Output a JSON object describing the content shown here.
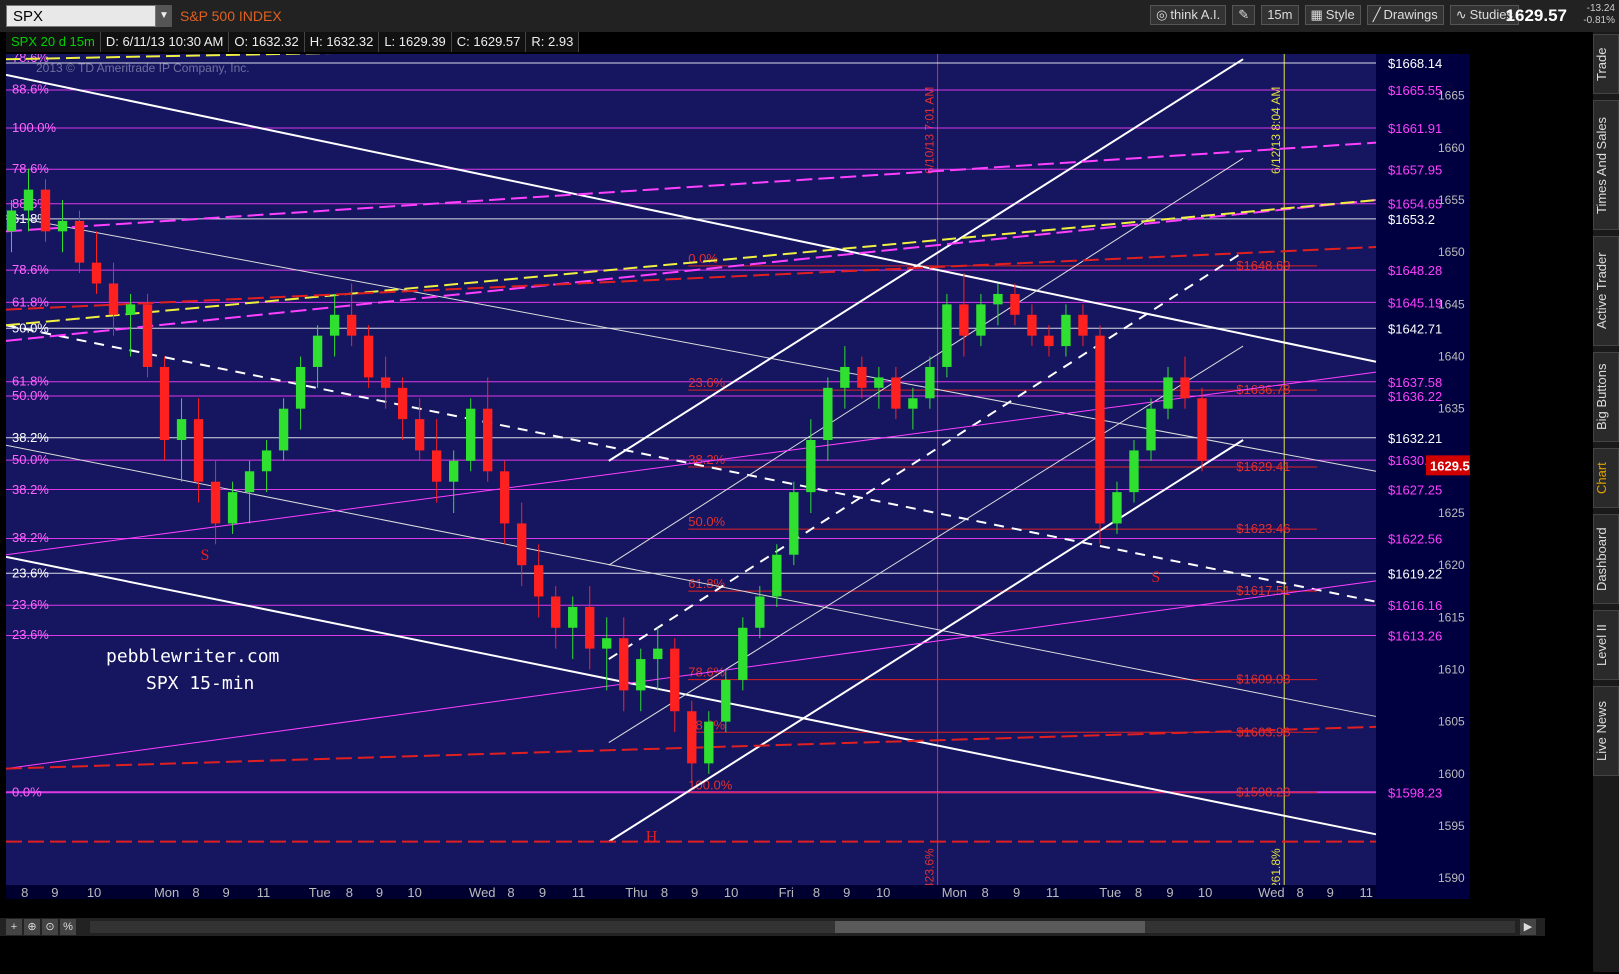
{
  "header": {
    "symbol": "SPX",
    "description": "S&P 500 INDEX",
    "last_price": "1629.57",
    "net_change": "-13.24",
    "pct_change": "-0.81%"
  },
  "toolbar": {
    "think_label": "think A.I.",
    "interval_label": "15m",
    "style_label": "Style",
    "drawings_label": "Drawings",
    "studies_label": "Studies"
  },
  "infobar": {
    "symbol_period": "SPX 20 d 15m",
    "date": "D: 6/11/13 10:30 AM",
    "open": "O: 1632.32",
    "high": "H: 1632.32",
    "low": "L: 1629.39",
    "close": "C: 1629.57",
    "range": "R: 2.93"
  },
  "sidetabs": [
    "Trade",
    "Times And Sales",
    "Active Trader",
    "Big Buttons",
    "Chart",
    "Dashboard",
    "Level II",
    "Live News"
  ],
  "chart_data": {
    "type": "candlestick",
    "title": "",
    "copyright": "2013 © TD Ameritrade IP Company, Inc.",
    "watermark_line1": "pebblewriter.com",
    "watermark_line2": "SPX 15-min",
    "ylim": [
      1588,
      1669
    ],
    "last_price_label": "1629.57",
    "y_ticks": [
      1590,
      1595,
      1600,
      1605,
      1610,
      1615,
      1620,
      1625,
      1630,
      1635,
      1640,
      1645,
      1650,
      1655,
      1660,
      1665
    ],
    "x_ticks": [
      {
        "label": "8",
        "x": 0.011
      },
      {
        "label": "9",
        "x": 0.033
      },
      {
        "label": "10",
        "x": 0.059
      },
      {
        "label": "Mon",
        "x": 0.108
      },
      {
        "label": "8",
        "x": 0.136
      },
      {
        "label": "9",
        "x": 0.158
      },
      {
        "label": "11",
        "x": 0.183
      },
      {
        "label": "Tue",
        "x": 0.221
      },
      {
        "label": "8",
        "x": 0.248
      },
      {
        "label": "9",
        "x": 0.27
      },
      {
        "label": "10",
        "x": 0.293
      },
      {
        "label": "Wed",
        "x": 0.338
      },
      {
        "label": "8",
        "x": 0.366
      },
      {
        "label": "9",
        "x": 0.389
      },
      {
        "label": "11",
        "x": 0.413
      },
      {
        "label": "Thu",
        "x": 0.452
      },
      {
        "label": "8",
        "x": 0.478
      },
      {
        "label": "9",
        "x": 0.5
      },
      {
        "label": "10",
        "x": 0.524
      },
      {
        "label": "Fri",
        "x": 0.564
      },
      {
        "label": "8",
        "x": 0.589
      },
      {
        "label": "9",
        "x": 0.611
      },
      {
        "label": "10",
        "x": 0.635
      },
      {
        "label": "Mon",
        "x": 0.683
      },
      {
        "label": "8",
        "x": 0.712
      },
      {
        "label": "9",
        "x": 0.735
      },
      {
        "label": "11",
        "x": 0.759
      },
      {
        "label": "Tue",
        "x": 0.798
      },
      {
        "label": "8",
        "x": 0.824
      },
      {
        "label": "9",
        "x": 0.847
      },
      {
        "label": "10",
        "x": 0.87
      },
      {
        "label": "Wed",
        "x": 0.914
      },
      {
        "label": "8",
        "x": 0.942
      },
      {
        "label": "9",
        "x": 0.964
      },
      {
        "label": "11",
        "x": 0.988
      }
    ],
    "vertical_markers": [
      {
        "x": 0.68,
        "label": "6/10/13 7:01 AM",
        "color": "#e03030",
        "bottom_label": "423.6%"
      },
      {
        "x": 0.933,
        "label": "6/12/13 8:04 AM",
        "color": "#e0e040",
        "bottom_label": "261.8%"
      }
    ],
    "right_levels": [
      {
        "price": 1668.14,
        "label": "$1668.14",
        "color": "#ffffff"
      },
      {
        "price": 1665.55,
        "label": "$1665.55",
        "color": "#ff40ff"
      },
      {
        "price": 1661.91,
        "label": "$1661.91",
        "color": "#ff40ff"
      },
      {
        "price": 1657.95,
        "label": "$1657.95",
        "color": "#ff40ff"
      },
      {
        "price": 1654.65,
        "label": "$1654.65",
        "color": "#ff40ff"
      },
      {
        "price": 1653.2,
        "label": "$1653.2",
        "color": "#ffffff"
      },
      {
        "price": 1648.28,
        "label": "$1648.28",
        "color": "#ff40ff"
      },
      {
        "price": 1645.19,
        "label": "$1645.19",
        "color": "#ff40ff"
      },
      {
        "price": 1642.71,
        "label": "$1642.71",
        "color": "#ffffff"
      },
      {
        "price": 1637.58,
        "label": "$1637.58",
        "color": "#ff40ff"
      },
      {
        "price": 1636.22,
        "label": "$1636.22",
        "color": "#ff40ff"
      },
      {
        "price": 1632.21,
        "label": "$1632.21",
        "color": "#ffffff"
      },
      {
        "price": 1630.07,
        "label": "$1630.07",
        "color": "#ff40ff"
      },
      {
        "price": 1627.25,
        "label": "$1627.25",
        "color": "#ff40ff"
      },
      {
        "price": 1622.56,
        "label": "$1622.56",
        "color": "#ff40ff"
      },
      {
        "price": 1619.22,
        "label": "$1619.22",
        "color": "#ffffff"
      },
      {
        "price": 1616.16,
        "label": "$1616.16",
        "color": "#ff40ff"
      },
      {
        "price": 1613.26,
        "label": "$1613.26",
        "color": "#ff40ff"
      },
      {
        "price": 1598.23,
        "label": "$1598.23",
        "color": "#ff40ff"
      }
    ],
    "left_fib_labels": [
      {
        "price": 1668.6,
        "label": "78.6%",
        "color": "#ff66ff"
      },
      {
        "price": 1665.6,
        "label": "88.6%",
        "color": "#ff66ff"
      },
      {
        "price": 1661.9,
        "label": "100.0%",
        "color": "#ff66ff"
      },
      {
        "price": 1658.0,
        "label": "78.6%",
        "color": "#ff66ff"
      },
      {
        "price": 1654.6,
        "label": "88.6%",
        "color": "#ff66ff"
      },
      {
        "price": 1653.2,
        "label": "61.8%",
        "color": "#ffffff"
      },
      {
        "price": 1648.3,
        "label": "78.6%",
        "color": "#ff66ff"
      },
      {
        "price": 1645.2,
        "label": "61.8%",
        "color": "#ff66ff"
      },
      {
        "price": 1642.7,
        "label": "50.0%",
        "color": "#ffffff"
      },
      {
        "price": 1637.6,
        "label": "61.8%",
        "color": "#ff66ff"
      },
      {
        "price": 1636.2,
        "label": "50.0%",
        "color": "#ff66ff"
      },
      {
        "price": 1632.2,
        "label": "38.2%",
        "color": "#ffffff"
      },
      {
        "price": 1630.1,
        "label": "50.0%",
        "color": "#ff66ff"
      },
      {
        "price": 1627.2,
        "label": "38.2%",
        "color": "#ff66ff"
      },
      {
        "price": 1622.6,
        "label": "38.2%",
        "color": "#ff66ff"
      },
      {
        "price": 1619.2,
        "label": "23.6%",
        "color": "#ffffff"
      },
      {
        "price": 1616.2,
        "label": "23.6%",
        "color": "#ff66ff"
      },
      {
        "price": 1613.3,
        "label": "23.6%",
        "color": "#ff66ff"
      },
      {
        "price": 1598.2,
        "label": "0.0%",
        "color": "#ff66ff"
      }
    ],
    "red_fib_levels": [
      {
        "price": 1648.69,
        "pct": "0.0%",
        "label": "$1648.69"
      },
      {
        "price": 1636.78,
        "pct": "23.6%",
        "label": "$1636.78"
      },
      {
        "price": 1629.41,
        "pct": "38.2%",
        "label": "$1629.41"
      },
      {
        "price": 1623.46,
        "pct": "50.0%",
        "label": "$1623.46"
      },
      {
        "price": 1617.51,
        "pct": "61.8%",
        "label": "$1617.51"
      },
      {
        "price": 1609.03,
        "pct": "78.6%",
        "label": "$1609.03"
      },
      {
        "price": 1603.98,
        "pct": "88.6%",
        "label": "$1603.98"
      },
      {
        "price": 1598.23,
        "pct": "100.0%",
        "label": "$1598.23"
      }
    ],
    "pattern_labels": [
      {
        "label": "S",
        "x": 0.142,
        "price": 1620.5
      },
      {
        "label": "H",
        "x": 0.467,
        "price": 1593.5
      },
      {
        "label": "S",
        "x": 0.836,
        "price": 1618.4
      }
    ],
    "candles": [
      [
        1652,
        1655,
        1650,
        1654
      ],
      [
        1654,
        1658,
        1652,
        1656
      ],
      [
        1656,
        1657,
        1651,
        1652
      ],
      [
        1652,
        1655,
        1650,
        1653
      ],
      [
        1653,
        1654,
        1648,
        1649
      ],
      [
        1649,
        1652,
        1646,
        1647
      ],
      [
        1647,
        1649,
        1642,
        1644
      ],
      [
        1644,
        1646,
        1640,
        1645
      ],
      [
        1645,
        1646,
        1638,
        1639
      ],
      [
        1639,
        1640,
        1630,
        1632
      ],
      [
        1632,
        1636,
        1628,
        1634
      ],
      [
        1634,
        1636,
        1626,
        1628
      ],
      [
        1628,
        1630,
        1622,
        1624
      ],
      [
        1624,
        1628,
        1623,
        1627
      ],
      [
        1627,
        1630,
        1624,
        1629
      ],
      [
        1629,
        1632,
        1627,
        1631
      ],
      [
        1631,
        1636,
        1630,
        1635
      ],
      [
        1635,
        1640,
        1633,
        1639
      ],
      [
        1639,
        1643,
        1637,
        1642
      ],
      [
        1642,
        1646,
        1640,
        1644
      ],
      [
        1644,
        1647,
        1641,
        1642
      ],
      [
        1642,
        1643,
        1637,
        1638
      ],
      [
        1638,
        1640,
        1635,
        1637
      ],
      [
        1637,
        1638,
        1632,
        1634
      ],
      [
        1634,
        1636,
        1630,
        1631
      ],
      [
        1631,
        1634,
        1626,
        1628
      ],
      [
        1628,
        1631,
        1625,
        1630
      ],
      [
        1630,
        1636,
        1629,
        1635
      ],
      [
        1635,
        1638,
        1628,
        1629
      ],
      [
        1629,
        1630,
        1622,
        1624
      ],
      [
        1624,
        1626,
        1618,
        1620
      ],
      [
        1620,
        1622,
        1615,
        1617
      ],
      [
        1617,
        1618,
        1612,
        1614
      ],
      [
        1614,
        1617,
        1611,
        1616
      ],
      [
        1616,
        1618,
        1610,
        1612
      ],
      [
        1612,
        1615,
        1608,
        1613
      ],
      [
        1613,
        1615,
        1606,
        1608
      ],
      [
        1608,
        1612,
        1606,
        1611
      ],
      [
        1611,
        1614,
        1608,
        1612
      ],
      [
        1612,
        1613,
        1604,
        1606
      ],
      [
        1606,
        1607,
        1599,
        1601
      ],
      [
        1601,
        1606,
        1600,
        1605
      ],
      [
        1605,
        1610,
        1604,
        1609
      ],
      [
        1609,
        1615,
        1608,
        1614
      ],
      [
        1614,
        1618,
        1613,
        1617
      ],
      [
        1617,
        1622,
        1616,
        1621
      ],
      [
        1621,
        1628,
        1620,
        1627
      ],
      [
        1627,
        1634,
        1625,
        1632
      ],
      [
        1632,
        1638,
        1630,
        1637
      ],
      [
        1637,
        1641,
        1635,
        1639
      ],
      [
        1639,
        1640,
        1636,
        1637
      ],
      [
        1637,
        1639,
        1635,
        1638
      ],
      [
        1638,
        1639,
        1634,
        1635
      ],
      [
        1635,
        1637,
        1633,
        1636
      ],
      [
        1636,
        1640,
        1635,
        1639
      ],
      [
        1639,
        1646,
        1638,
        1645
      ],
      [
        1645,
        1648,
        1640,
        1642
      ],
      [
        1642,
        1646,
        1641,
        1645
      ],
      [
        1645,
        1647,
        1643,
        1646
      ],
      [
        1646,
        1647,
        1643,
        1644
      ],
      [
        1644,
        1645,
        1641,
        1642
      ],
      [
        1642,
        1643,
        1640,
        1641
      ],
      [
        1641,
        1645,
        1640,
        1644
      ],
      [
        1644,
        1645,
        1641,
        1642
      ],
      [
        1642,
        1643,
        1622,
        1624
      ],
      [
        1624,
        1628,
        1623,
        1627
      ],
      [
        1627,
        1632,
        1626,
        1631
      ],
      [
        1631,
        1636,
        1630,
        1635
      ],
      [
        1635,
        1639,
        1634,
        1638
      ],
      [
        1638,
        1640,
        1635,
        1636
      ],
      [
        1636,
        1637,
        1629,
        1630
      ]
    ]
  }
}
